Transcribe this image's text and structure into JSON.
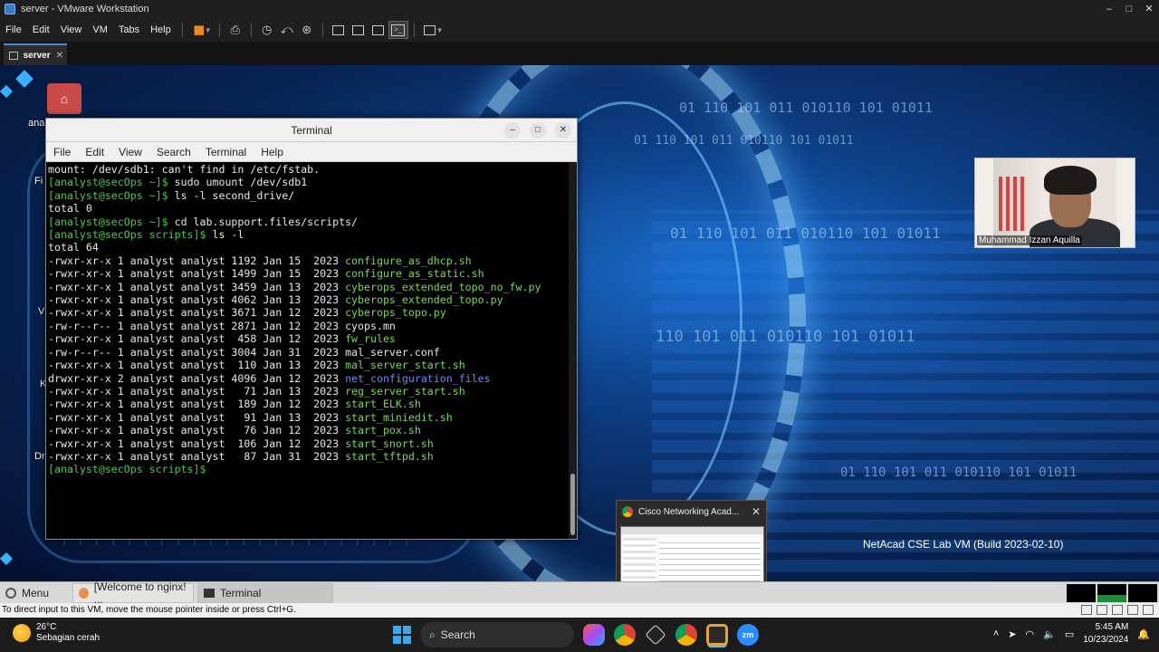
{
  "window": {
    "title": "server - VMware Workstation",
    "controls": [
      "–",
      "□",
      "✕"
    ]
  },
  "menubar": {
    "items": [
      "File",
      "Edit",
      "View",
      "VM",
      "Tabs",
      "Help"
    ]
  },
  "tabs": [
    {
      "label": "server"
    }
  ],
  "desktop": {
    "labels": [
      "ana",
      "Fi",
      "V",
      "K",
      "Dr"
    ],
    "binary_lines": [
      "01 110 101 011 010110 101 01011",
      "01 110 101 011 010110 101 01011",
      "01 110 101 011 010110 101 01011",
      "110 101 011 010110 101 01011",
      "01 110 101 011 010110 101 01011"
    ],
    "build_text": "NetAcad CSE Lab VM (Build 2023-02-10)"
  },
  "terminal": {
    "title": "Terminal",
    "menu": [
      "File",
      "Edit",
      "View",
      "Search",
      "Terminal",
      "Help"
    ],
    "lines": [
      {
        "text": "mount: /dev/sdb1: can't find in /etc/fstab."
      },
      {
        "prompt": "[analyst@secOps ~]$",
        "text": " sudo umount /dev/sdb1"
      },
      {
        "prompt": "[analyst@secOps ~]$",
        "text": " ls -l second_drive/"
      },
      {
        "text": "total 0"
      },
      {
        "prompt": "[analyst@secOps ~]$",
        "text": " cd lab.support.files/scripts/"
      },
      {
        "prompt": "[analyst@secOps scripts]$",
        "text": " ls -l"
      },
      {
        "text": "total 64"
      },
      {
        "text": "-rwxr-xr-x 1 analyst analyst 1192 Jan 15  2023 ",
        "file": "configure_as_dhcp.sh",
        "kind": "exe"
      },
      {
        "text": "-rwxr-xr-x 1 analyst analyst 1499 Jan 15  2023 ",
        "file": "configure_as_static.sh",
        "kind": "exe"
      },
      {
        "text": "-rwxr-xr-x 1 analyst analyst 3459 Jan 13  2023 ",
        "file": "cyberops_extended_topo_no_fw.py",
        "kind": "exe"
      },
      {
        "text": "-rwxr-xr-x 1 analyst analyst 4062 Jan 13  2023 ",
        "file": "cyberops_extended_topo.py",
        "kind": "exe"
      },
      {
        "text": "-rwxr-xr-x 1 analyst analyst 3671 Jan 12  2023 ",
        "file": "cyberops_topo.py",
        "kind": "exe"
      },
      {
        "text": "-rw-r--r-- 1 analyst analyst 2871 Jan 12  2023 ",
        "file": "cyops.mn",
        "kind": "plain"
      },
      {
        "text": "-rwxr-xr-x 1 analyst analyst  458 Jan 12  2023 ",
        "file": "fw_rules",
        "kind": "exe"
      },
      {
        "text": "-rw-r--r-- 1 analyst analyst 3004 Jan 31  2023 ",
        "file": "mal_server.conf",
        "kind": "plain"
      },
      {
        "text": "-rwxr-xr-x 1 analyst analyst  110 Jan 13  2023 ",
        "file": "mal_server_start.sh",
        "kind": "exe"
      },
      {
        "text": "drwxr-xr-x 2 analyst analyst 4096 Jan 12  2023 ",
        "file": "net_configuration_files",
        "kind": "dir"
      },
      {
        "text": "-rwxr-xr-x 1 analyst analyst   71 Jan 13  2023 ",
        "file": "reg_server_start.sh",
        "kind": "exe"
      },
      {
        "text": "-rwxr-xr-x 1 analyst analyst  189 Jan 12  2023 ",
        "file": "start_ELK.sh",
        "kind": "exe"
      },
      {
        "text": "-rwxr-xr-x 1 analyst analyst   91 Jan 13  2023 ",
        "file": "start_miniedit.sh",
        "kind": "exe"
      },
      {
        "text": "-rwxr-xr-x 1 analyst analyst   76 Jan 12  2023 ",
        "file": "start_pox.sh",
        "kind": "exe"
      },
      {
        "text": "-rwxr-xr-x 1 analyst analyst  106 Jan 12  2023 ",
        "file": "start_snort.sh",
        "kind": "exe"
      },
      {
        "text": "-rwxr-xr-x 1 analyst analyst   87 Jan 31  2023 ",
        "file": "start_tftpd.sh",
        "kind": "exe"
      },
      {
        "prompt": "[analyst@secOps scripts]$",
        "text": " "
      }
    ]
  },
  "webcam": {
    "name": "Muhammad Izzan Aquilla"
  },
  "thumbnail": {
    "title": "Cisco Networking Acad...",
    "close": "✕"
  },
  "guest_taskbar": {
    "menu": "Menu",
    "windows": [
      {
        "label": "[Welcome to nginx! ..."
      },
      {
        "label": "Terminal"
      }
    ]
  },
  "vm_status": {
    "text": "To direct input to this VM, move the mouse pointer inside or press Ctrl+G."
  },
  "win_taskbar": {
    "weather_temp": "26°C",
    "weather_desc": "Sebagian cerah",
    "search_label": "Search",
    "time": "5:45 AM",
    "date": "10/23/2024",
    "zoom_label": "zm"
  }
}
